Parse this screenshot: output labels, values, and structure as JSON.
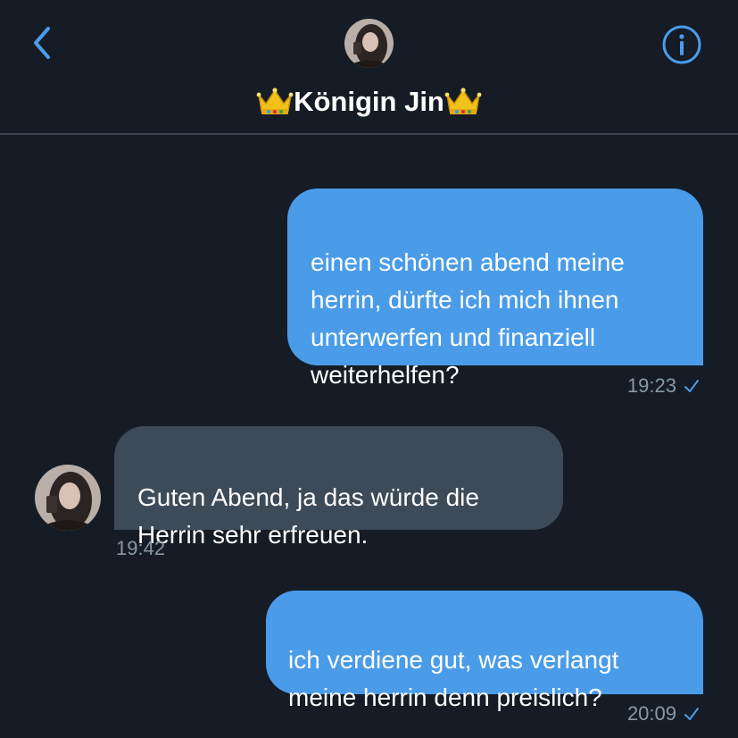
{
  "header": {
    "contact_name": "Königin Jin",
    "icons": {
      "back": "chevron-left-icon",
      "info": "info-circle-icon",
      "crown": "crown-emoji"
    },
    "accent_color": "#4a9ce9"
  },
  "messages": [
    {
      "direction": "sent",
      "text": "einen schönen abend meine\nherrin, dürfte ich mich ihnen\nunterwerfen und finanziell\nweiterhelfen?",
      "time": "19:23",
      "read_check": true
    },
    {
      "direction": "received",
      "text": "Guten Abend, ja das würde die\nHerrin sehr erfreuen.",
      "time": "19:42"
    },
    {
      "direction": "sent",
      "text": "ich verdiene gut, was verlangt\nmeine herrin denn preislich?",
      "time": "20:09",
      "read_check": true
    }
  ],
  "colors": {
    "background": "#151c26",
    "sent_bubble": "#4a9ce9",
    "received_bubble": "#3d4a58",
    "timestamp": "#8899a6"
  }
}
